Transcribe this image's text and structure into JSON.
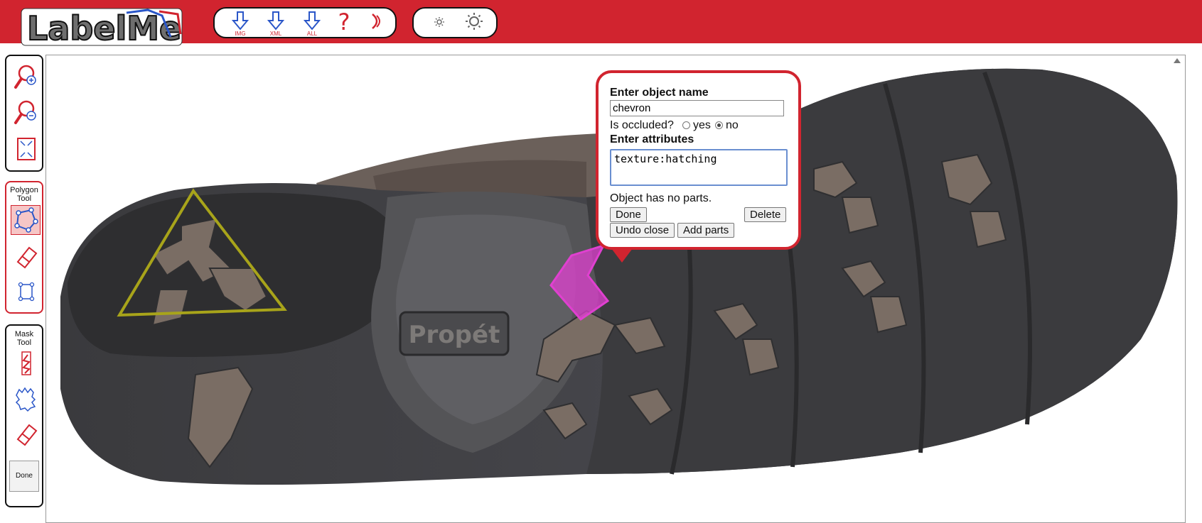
{
  "app": {
    "logo_text": "LabelMe"
  },
  "toolbar": {
    "download_img_label": "IMG",
    "download_xml_label": "XML",
    "download_all_label": "ALL",
    "help_label": "?",
    "brightness_down_icon": "sun-small-icon",
    "brightness_up_icon": "sun-large-icon"
  },
  "sidebar": {
    "polygon_tool_title": "Polygon\nTool",
    "mask_tool_title": "Mask\nTool",
    "mask_done_label": "Done"
  },
  "image": {
    "logo_text": "Propét"
  },
  "dialog": {
    "name_heading": "Enter object name",
    "name_value": "chevron",
    "occluded_label": "Is occluded?",
    "yes_label": "yes",
    "no_label": "no",
    "occluded_selected": "no",
    "attributes_heading": "Enter attributes",
    "attributes_value": "texture:hatching",
    "parts_text": "Object has no parts.",
    "done_label": "Done",
    "delete_label": "Delete",
    "undo_close_label": "Undo close",
    "add_parts_label": "Add parts"
  },
  "colors": {
    "brand_red": "#d1242f",
    "annotation_triangle": "#a8a41a",
    "annotation_chevron": "#e040d0"
  }
}
